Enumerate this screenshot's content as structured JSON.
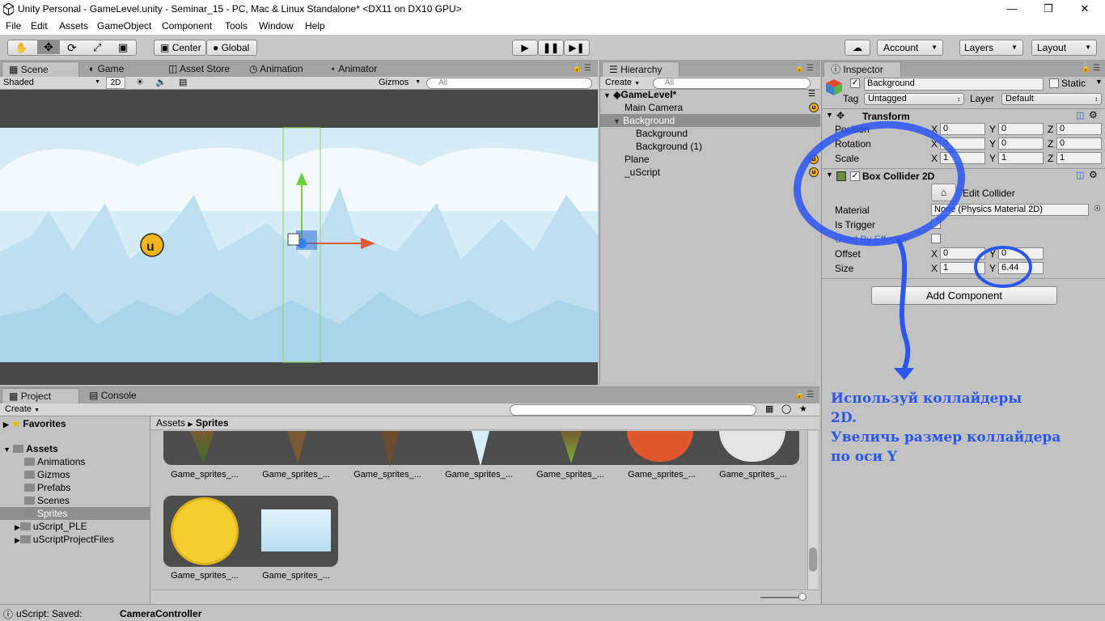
{
  "window": {
    "title": "Unity Personal - GameLevel.unity - Seminar_15 - PC, Mac & Linux Standalone* <DX11 on DX10 GPU>"
  },
  "menu": [
    "File",
    "Edit",
    "Assets",
    "GameObject",
    "Component",
    "Tools",
    "Window",
    "Help"
  ],
  "toolbar": {
    "pivot": "Center",
    "space": "Global",
    "account": "Account",
    "layers": "Layers",
    "layout": "Layout"
  },
  "scene_tabs": [
    "Scene",
    "Game",
    "Asset Store",
    "Animation",
    "Animator"
  ],
  "scene_toolbar": {
    "shading": "Shaded",
    "mode_2d": "2D",
    "gizmos": "Gizmos",
    "search_placeholder": "All"
  },
  "hierarchy": {
    "tab": "Hierarchy",
    "create": "Create",
    "search_placeholder": "All",
    "scene": "GameLevel*",
    "items": [
      {
        "label": "Main Camera"
      },
      {
        "label": "Background"
      },
      {
        "label": "Background"
      },
      {
        "label": "Background (1)"
      },
      {
        "label": "Plane"
      },
      {
        "label": "_uScript"
      }
    ]
  },
  "inspector": {
    "tab": "Inspector",
    "object_name": "Background",
    "static_label": "Static",
    "tag_label": "Tag",
    "tag_value": "Untagged",
    "layer_label": "Layer",
    "layer_value": "Default",
    "transform": {
      "title": "Transform",
      "position_label": "Position",
      "rotation_label": "Rotation",
      "scale_label": "Scale",
      "position": [
        "0",
        "0",
        "0"
      ],
      "rotation": [
        "0",
        "0",
        "0"
      ],
      "scale": [
        "1",
        "1",
        "1"
      ]
    },
    "collider": {
      "title": "Box Collider 2D",
      "edit_collider": "Edit Collider",
      "material_label": "Material",
      "material_value": "None (Physics Material 2D)",
      "is_trigger_label": "Is Trigger",
      "used_by_effector_label": "Used By Effector",
      "offset_label": "Offset",
      "size_label": "Size",
      "offset": [
        "0",
        "0"
      ],
      "size": [
        "1",
        "6.44"
      ]
    },
    "add_component": "Add Component"
  },
  "axis": {
    "x": "X",
    "y": "Y",
    "z": "Z"
  },
  "project": {
    "tabs": [
      "Project",
      "Console"
    ],
    "create": "Create",
    "favorites": "Favorites",
    "assets": "Assets",
    "folders": [
      "Animations",
      "Gizmos",
      "Prefabs",
      "Scenes",
      "Sprites",
      "uScript_PLE",
      "uScriptProjectFiles"
    ],
    "breadcrumb": [
      "Assets",
      "Sprites"
    ],
    "thumbnails": [
      "Game_sprites_...",
      "Game_sprites_...",
      "Game_sprites_...",
      "Game_sprites_...",
      "Game_sprites_...",
      "Game_sprites_...",
      "Game_sprites_...",
      "Game_sprites_...",
      "Game_sprites_..."
    ]
  },
  "status": {
    "message": "uScript: Saved:",
    "detail": "CameraController"
  },
  "annotation": {
    "line1": "Используй коллайдеры",
    "line2": "2D.",
    "line3": "Увеличь размер коллайдера",
    "line4": "по оси Y",
    "color": "#2a56f5"
  }
}
